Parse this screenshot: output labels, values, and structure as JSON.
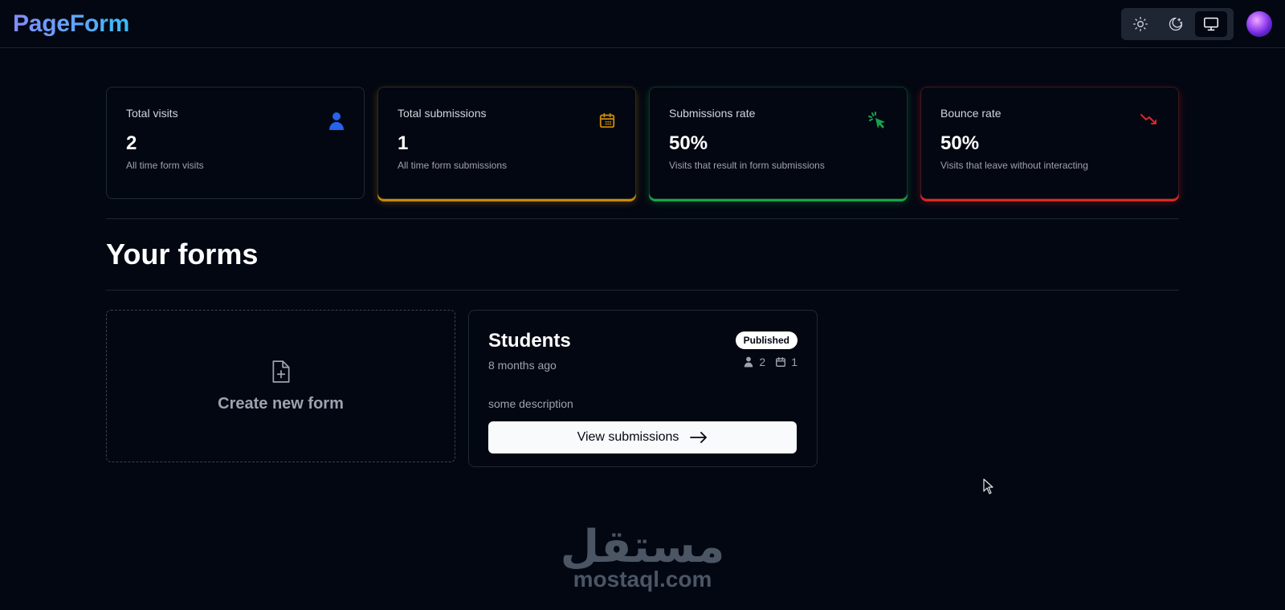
{
  "app": {
    "logo": "PageForm"
  },
  "theme": {
    "options": [
      {
        "icon": "sun-icon",
        "active": false
      },
      {
        "icon": "moon-icon",
        "active": false
      },
      {
        "icon": "monitor-icon",
        "active": true
      }
    ]
  },
  "stats": [
    {
      "title": "Total visits",
      "value": "2",
      "help": "All time form visits",
      "icon": "user-icon",
      "color": "#2563eb"
    },
    {
      "title": "Total submissions",
      "value": "1",
      "help": "All time form submissions",
      "icon": "calendar-icon",
      "color": "#ca8a04"
    },
    {
      "title": "Submissions rate",
      "value": "50%",
      "help": "Visits that result in form submissions",
      "icon": "cursor-click-icon",
      "color": "#16a34a"
    },
    {
      "title": "Bounce rate",
      "value": "50%",
      "help": "Visits that leave without interacting",
      "icon": "trending-down-icon",
      "color": "#dc2626"
    }
  ],
  "forms_section": {
    "heading": "Your forms",
    "create_label": "Create new form"
  },
  "forms": [
    {
      "name": "Students",
      "status": "Published",
      "created": "8 months ago",
      "visits": "2",
      "submissions": "1",
      "description": "some description",
      "action_label": "View submissions"
    }
  ],
  "watermark": {
    "arabic": "مستقل",
    "latin": "mostaql.com"
  }
}
